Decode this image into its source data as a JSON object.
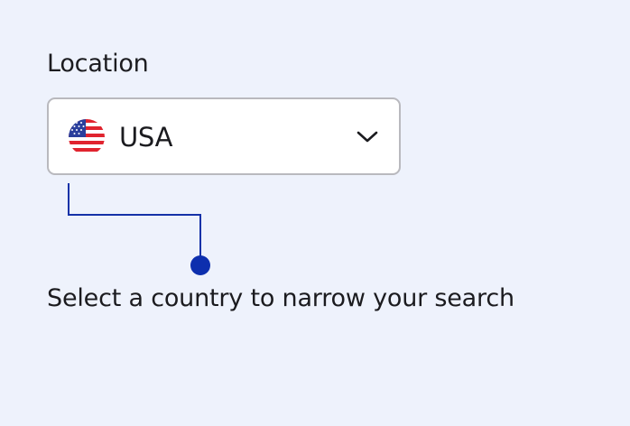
{
  "location_field": {
    "label": "Location",
    "selected_value": "USA",
    "flag_icon": "us-flag-icon",
    "dropdown_icon": "chevron-down-icon"
  },
  "helper": {
    "text": "Select a country to narrow your search"
  },
  "colors": {
    "background": "#eef2fc",
    "field_border": "#b9b9be",
    "field_background": "#ffffff",
    "connector": "#1532a8",
    "text": "#1b1b1f"
  }
}
